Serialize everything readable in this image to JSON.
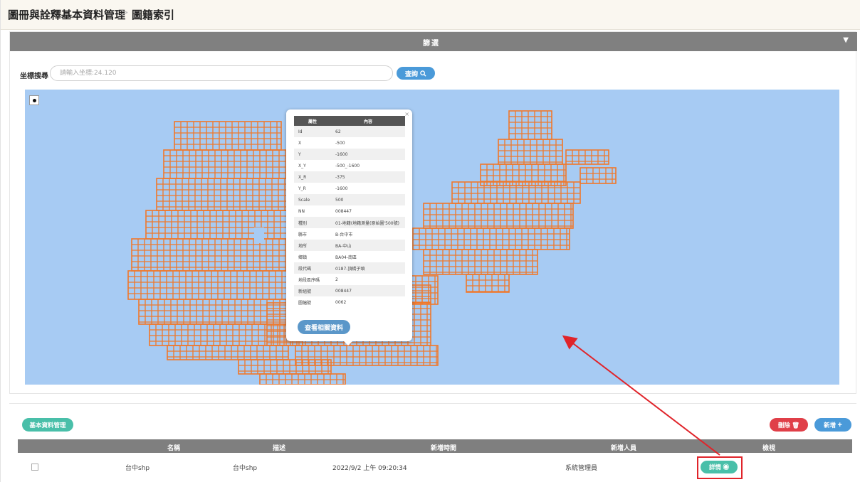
{
  "header": {
    "breadcrumb_parent": "圖冊與詮釋基本資料管理",
    "breadcrumb_separator": ">",
    "breadcrumb_current": "圖籍索引"
  },
  "filter": {
    "label": "篩選",
    "toggle_icon": "chevron-down-icon"
  },
  "search": {
    "label": "坐標搜尋",
    "placeholder": "請輸入坐標:24.120",
    "button_label": "查詢"
  },
  "map": {
    "marker_icon": "map-marker-icon",
    "background_color": "#a7cbf3",
    "tile_color": "#f0782a"
  },
  "popup": {
    "close_label": "×",
    "header_key": "屬性",
    "header_value": "內容",
    "rows": [
      {
        "k": "Id",
        "v": "62"
      },
      {
        "k": "X",
        "v": "-500"
      },
      {
        "k": "Y",
        "v": "-1600"
      },
      {
        "k": "X_Y",
        "v": "-500_-1600"
      },
      {
        "k": "X_R",
        "v": "-375"
      },
      {
        "k": "Y_R",
        "v": "-1600"
      },
      {
        "k": "Scale",
        "v": "500"
      },
      {
        "k": "NN",
        "v": "008447"
      },
      {
        "k": "種別",
        "v": "01-地籍(地籍測量(原始圖'500號)"
      },
      {
        "k": "縣市",
        "v": "B-台中市"
      },
      {
        "k": "地所",
        "v": "BA-中山"
      },
      {
        "k": "鄉鎮",
        "v": "BA04-南區"
      },
      {
        "k": "段代碼",
        "v": "0187-頂橋子頭"
      },
      {
        "k": "地段區序碼",
        "v": "2"
      },
      {
        "k": "新組號",
        "v": "008447"
      },
      {
        "k": "圖幅號",
        "v": "0062"
      }
    ],
    "button_label": "查看相關資料"
  },
  "toolbar": {
    "basic_button": "基本資料管理",
    "delete_button": "刪除",
    "add_button": "新增"
  },
  "table": {
    "columns": [
      "名稱",
      "描述",
      "新增時間",
      "新增人員",
      "檢視"
    ],
    "rows": [
      {
        "name": "台中shp",
        "description": "台中shp",
        "created_at": "2022/9/2 上午 09:20:34",
        "created_by": "系統管理員",
        "action": "詳情"
      }
    ]
  },
  "annotation": {
    "color": "#e0242a"
  }
}
